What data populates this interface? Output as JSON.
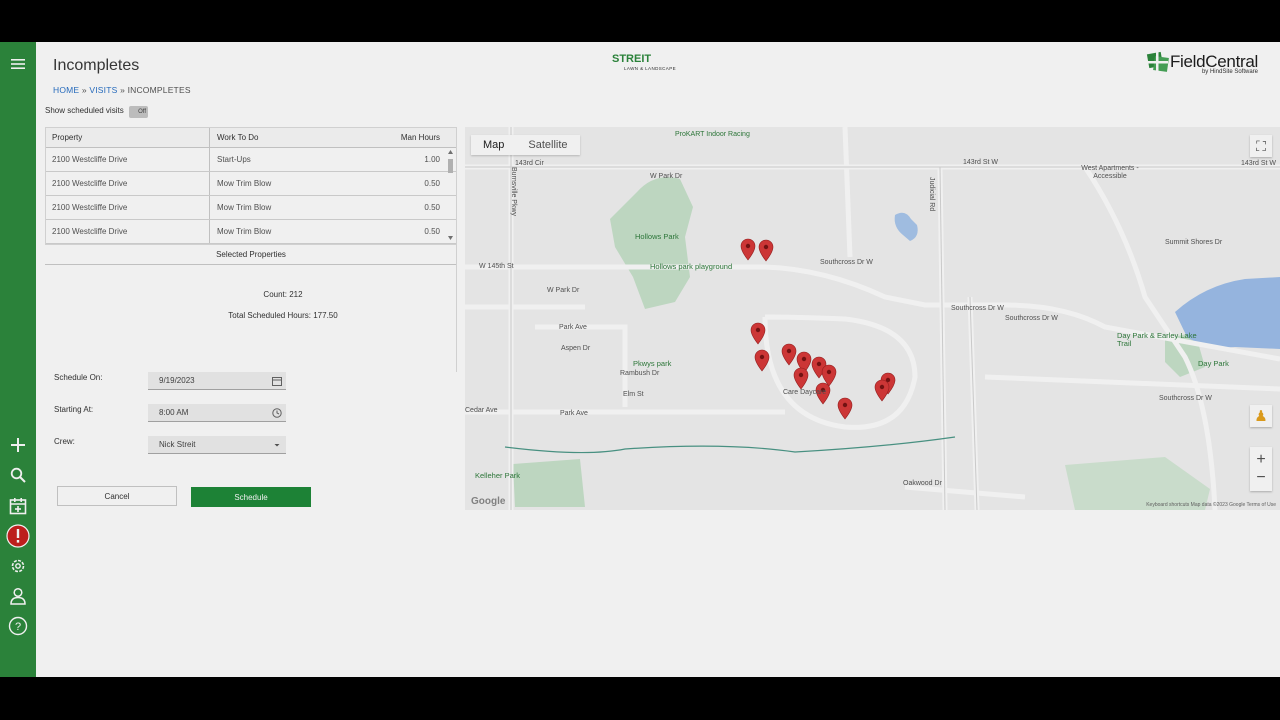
{
  "page": {
    "title": "Incompletes",
    "breadcrumb": [
      "HOME",
      "VISITS",
      "INCOMPLETES"
    ],
    "breadcrumb_sep": "»"
  },
  "brand": {
    "client_logo": "STREIT",
    "client_logo_sub": "LAWN & LANDSCAPE",
    "app_name": "FieldCentral",
    "app_sub": "by HindSite Software"
  },
  "toggle": {
    "label": "Show scheduled visits",
    "state": "Off"
  },
  "table": {
    "headers": [
      "Property",
      "Work To Do",
      "Man Hours"
    ],
    "rows": [
      [
        "2100 Westcliffe Drive",
        "Start-Ups",
        "1.00"
      ],
      [
        "2100 Westcliffe Drive",
        "Mow Trim Blow",
        "0.50"
      ],
      [
        "2100 Westcliffe Drive",
        "Mow Trim Blow",
        "0.50"
      ],
      [
        "2100 Westcliffe Drive",
        "Mow Trim Blow",
        "0.50"
      ]
    ]
  },
  "selected": {
    "title": "Selected Properties",
    "count_label": "Count: 212",
    "total_label": "Total Scheduled Hours: 177.50"
  },
  "form": {
    "schedule_on_label": "Schedule On:",
    "schedule_on_value": "9/19/2023",
    "starting_at_label": "Starting At:",
    "starting_at_value": "8:00 AM",
    "crew_label": "Crew:",
    "crew_value": "Nick Streit"
  },
  "buttons": {
    "cancel": "Cancel",
    "schedule": "Schedule"
  },
  "map": {
    "tabs": [
      "Map",
      "Satellite"
    ],
    "labels": {
      "prokart": "ProKART Indoor Racing",
      "cir143": "143rd Cir",
      "w143": "143rd St W",
      "w143b": "143rd St W",
      "west_apts": "West Apartments - Accessible",
      "w_park_dr_top": "W Park Dr",
      "hollows": "Hollows Park",
      "hollows_play": "Hollows park playground",
      "w145": "W 145th St",
      "w_park_dr": "W Park Dr",
      "park_ave": "Park Ave",
      "aspen": "Aspen Dr",
      "pkwy_park": "Pkwys park",
      "rambush": "Rambush Dr",
      "elm": "Elm St",
      "cedar": "Cedar Ave",
      "southcross_w": "Southcross Dr W",
      "southcross_w2": "Southcross Dr W",
      "southcross_w3": "Southcross Dr W",
      "southcross_w4": "Southcross Dr W",
      "daycare": "Care Daycare",
      "kelleher": "Kelleher Park",
      "oakwood": "Oakwood Dr",
      "dayparkpond": "Day Park & Earley Lake Trail",
      "daypark": "Day Park",
      "summit": "Summit Shores Dr",
      "judicial": "Judicial Rd",
      "burnsville_pkwy": "Burnsville Pkwy",
      "footer": "Keyboard shortcuts   Map data ©2023 Google   Terms of Use",
      "google": "Google"
    }
  },
  "rail_icons": [
    "hamburger-icon",
    "plus-icon",
    "search-icon",
    "calendar-icon",
    "alert-icon",
    "gear-icon",
    "user-icon",
    "help-icon"
  ],
  "colors": {
    "rail": "#2e8b3e",
    "schedule_button": "#1f8b3a",
    "pin": "#d93a3a",
    "park": "#b9dcc0",
    "water": "#9cc0ec"
  }
}
